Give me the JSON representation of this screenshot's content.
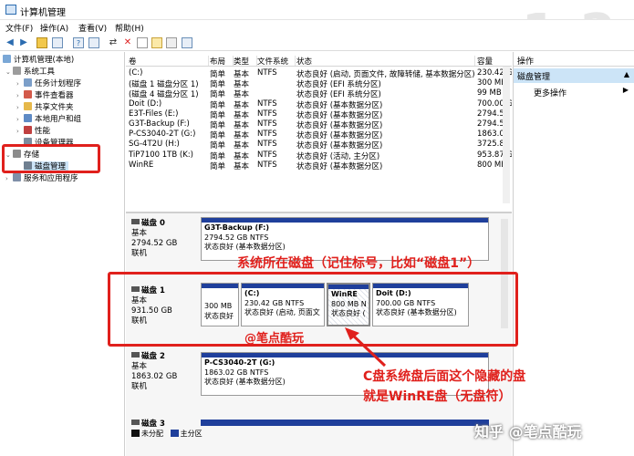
{
  "window": {
    "title": "计算机管理"
  },
  "watermark": "1.2",
  "menu": [
    "文件(F)",
    "操作(A)",
    "查看(V)",
    "帮助(H)"
  ],
  "tree": {
    "root": "计算机管理(本地)",
    "system_tools": "系统工具",
    "task_scheduler": "任务计划程序",
    "event_viewer": "事件查看器",
    "shared_folders": "共享文件夹",
    "local_users": "本地用户和组",
    "performance": "性能",
    "device_manager": "设备管理器",
    "storage": "存储",
    "disk_management": "磁盘管理",
    "services": "服务和应用程序"
  },
  "volume_table": {
    "headers": [
      "卷",
      "布局",
      "类型",
      "文件系统",
      "状态",
      "容量"
    ],
    "rows": [
      [
        "(C:)",
        "简单",
        "基本",
        "NTFS",
        "状态良好 (启动, 页面文件, 故障转储, 基本数据分区)",
        "230.42 G"
      ],
      [
        "(磁盘 1 磁盘分区 1)",
        "简单",
        "基本",
        "",
        "状态良好 (EFI 系统分区)",
        "300 MB"
      ],
      [
        "(磁盘 4 磁盘分区 1)",
        "简单",
        "基本",
        "",
        "状态良好 (EFI 系统分区)",
        "99 MB"
      ],
      [
        "Doit (D:)",
        "简单",
        "基本",
        "NTFS",
        "状态良好 (基本数据分区)",
        "700.00 G"
      ],
      [
        "E3T-Files (E:)",
        "简单",
        "基本",
        "NTFS",
        "状态良好 (基本数据分区)",
        "2794.52"
      ],
      [
        "G3T-Backup (F:)",
        "简单",
        "基本",
        "NTFS",
        "状态良好 (基本数据分区)",
        "2794.52"
      ],
      [
        "P-CS3040-2T (G:)",
        "简单",
        "基本",
        "NTFS",
        "状态良好 (基本数据分区)",
        "1863.02"
      ],
      [
        "SG-4T2U (H:)",
        "简单",
        "基本",
        "NTFS",
        "状态良好 (基本数据分区)",
        "3725.80"
      ],
      [
        "TiP7100 1TB (K:)",
        "简单",
        "基本",
        "NTFS",
        "状态良好 (活动, 主分区)",
        "953.87 G"
      ],
      [
        "WinRE",
        "简单",
        "基本",
        "NTFS",
        "状态良好 (基本数据分区)",
        "800 MB"
      ]
    ]
  },
  "disks": {
    "disk0": {
      "name": "磁盘 0",
      "type": "基本",
      "size": "2794.52 GB",
      "status": "联机",
      "part": {
        "name": "G3T-Backup  (F:)",
        "size": "2794.52 GB NTFS",
        "status": "状态良好 (基本数据分区)"
      }
    },
    "disk1": {
      "name": "磁盘 1",
      "type": "基本",
      "size": "931.50 GB",
      "status": "联机",
      "p1": {
        "size": "300 MB",
        "status": "状态良好"
      },
      "p2": {
        "name": "(C:)",
        "size": "230.42 GB NTFS",
        "status": "状态良好 (启动, 页面文"
      },
      "p3": {
        "name": "WinRE",
        "size": "800 MB N",
        "status": "状态良好 ("
      },
      "p4": {
        "name": "Doit  (D:)",
        "size": "700.00 GB NTFS",
        "status": "状态良好 (基本数据分区)"
      }
    },
    "disk2": {
      "name": "磁盘 2",
      "type": "基本",
      "size": "1863.02 GB",
      "status": "联机",
      "part": {
        "name": "P-CS3040-2T  (G:)",
        "size": "1863.02 GB NTFS",
        "status": "状态良好 (基本数据分区)"
      }
    },
    "disk3": {
      "name": "磁盘 3"
    }
  },
  "legend": {
    "unallocated": "未分配",
    "primary": "主分区"
  },
  "actions": {
    "header": "操作",
    "selected": "磁盘管理",
    "more": "更多操作"
  },
  "annotations": {
    "disk_note": "系统所在磁盘（记住标号，比如“磁盘1”）",
    "author": "@笔点酷玩",
    "winre_note_1": "C盘系统盘后面这个隐藏的盘",
    "winre_note_2": "就是WinRE盘（无盘符）",
    "zhihu": "知乎 @笔点酷玩"
  },
  "colors": {
    "accent_red": "#e0201c",
    "partition_bar": "#1f3f9b",
    "selection": "#cce4f7"
  }
}
